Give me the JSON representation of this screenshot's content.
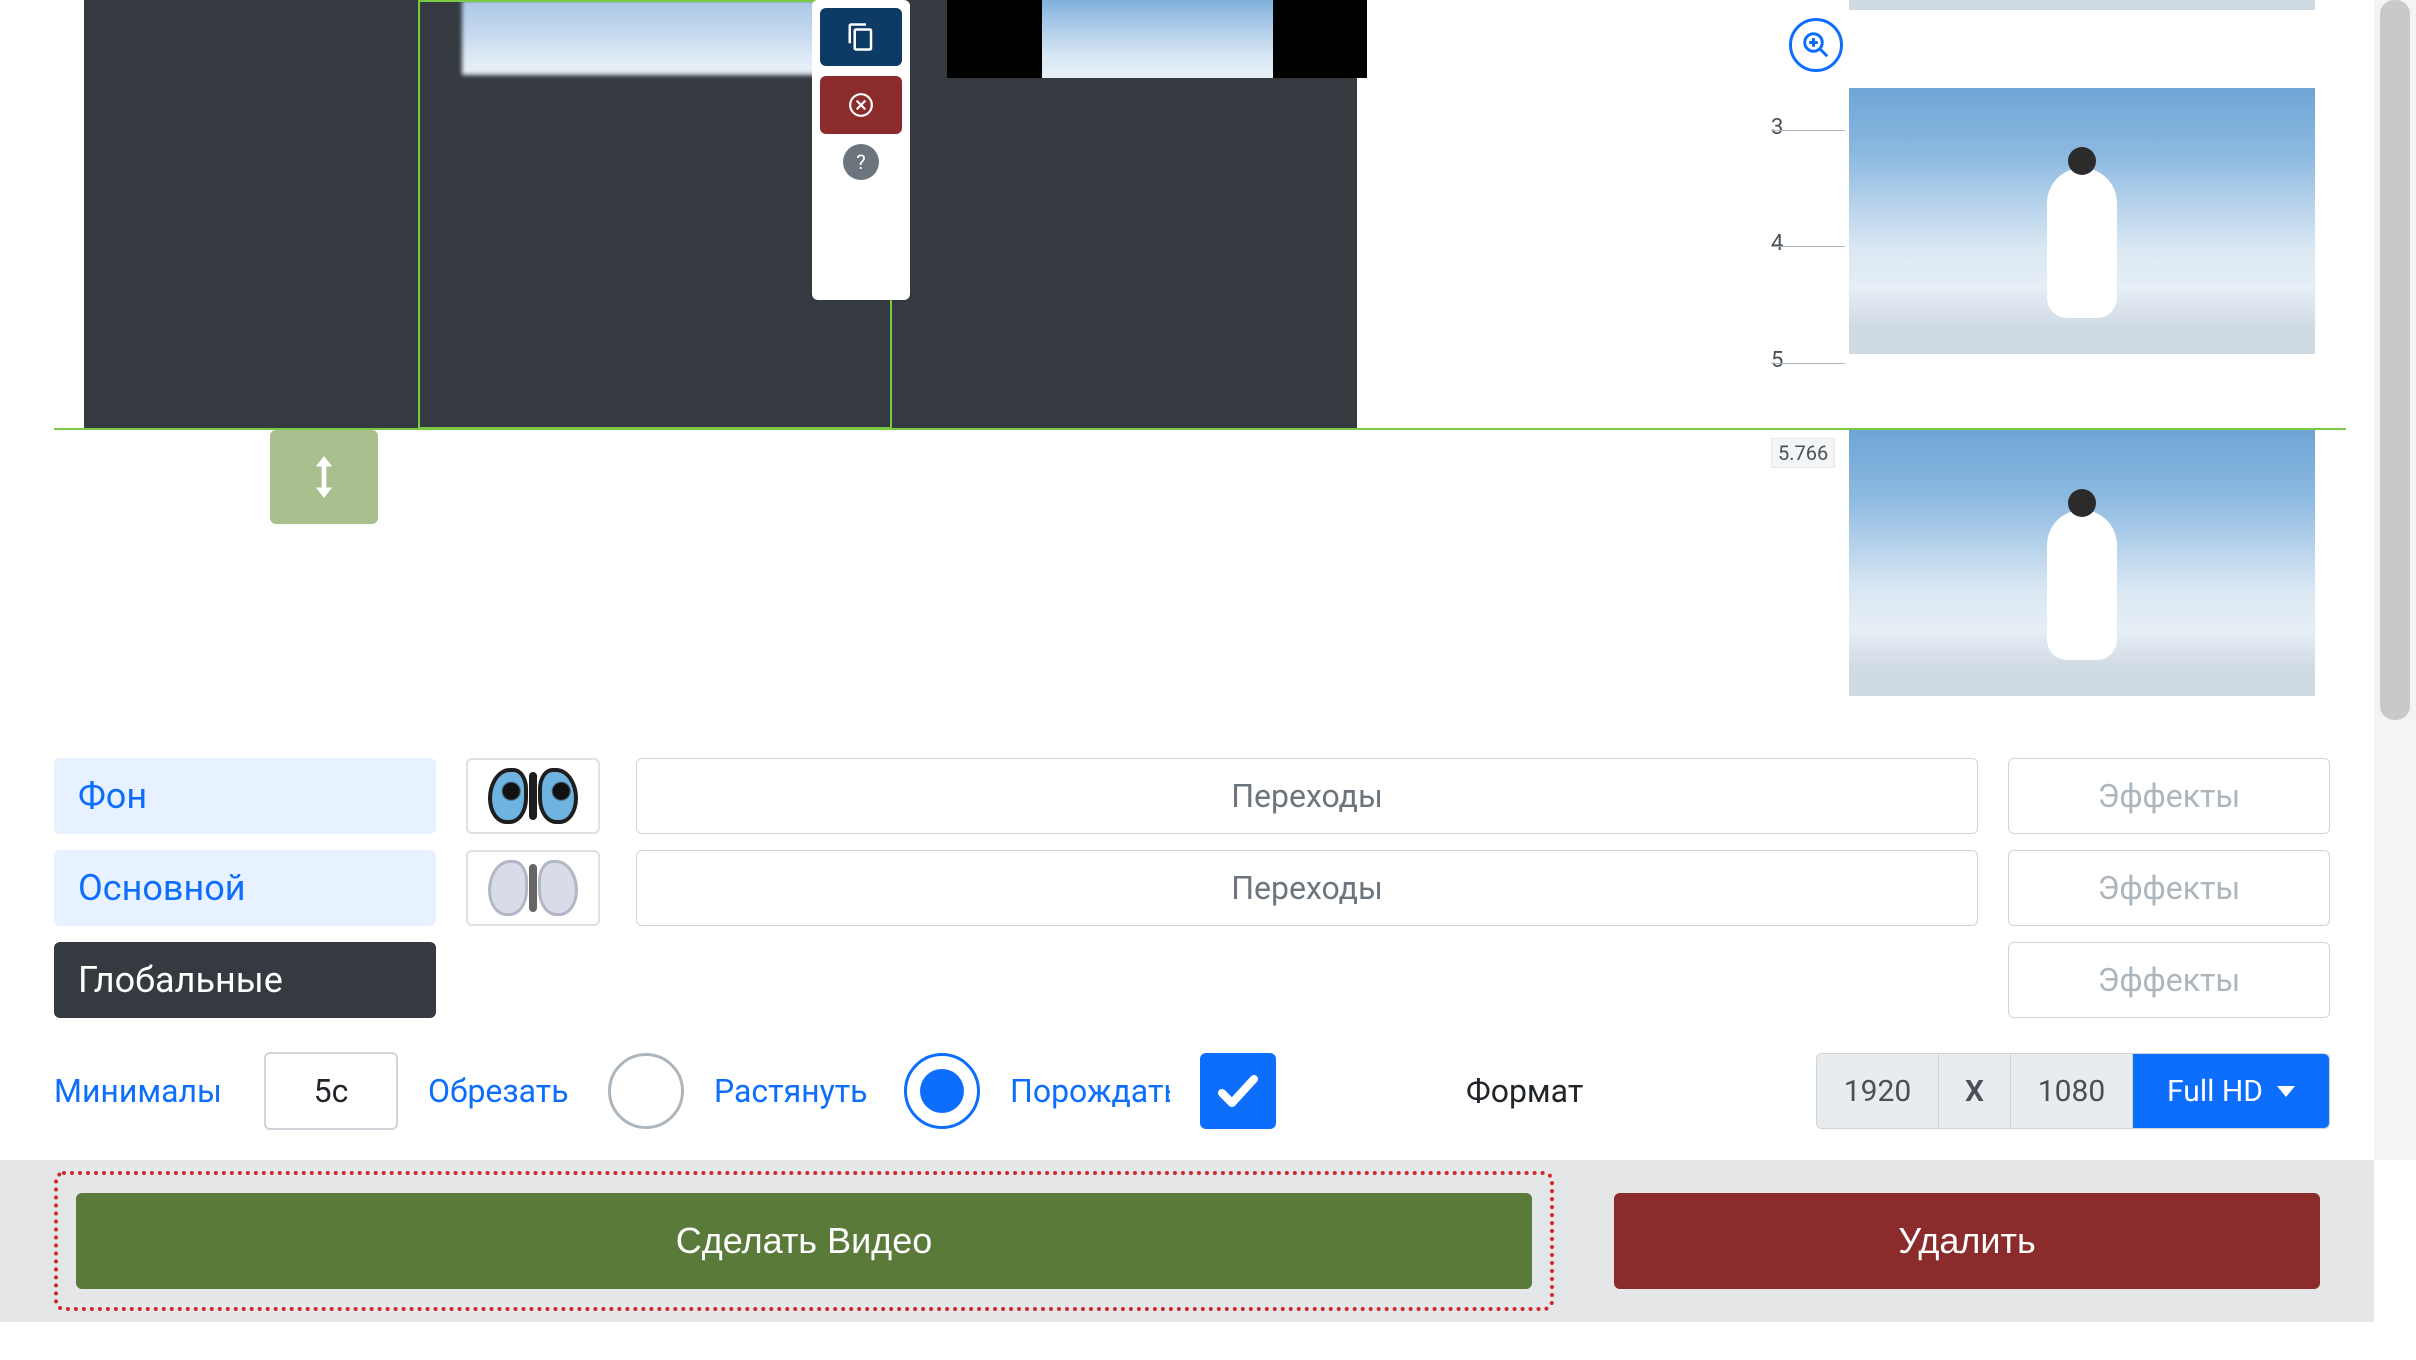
{
  "timeline": {
    "ticks": [
      "3",
      "4",
      "5",
      "5.766"
    ]
  },
  "toolbar": {
    "copy_icon": "copy",
    "delete_icon": "close",
    "help_icon": "?"
  },
  "layers": {
    "bg_label": "Фон",
    "main_label": "Основной",
    "global_label": "Глобальные"
  },
  "row_controls": {
    "transitions_placeholder": "Переходы",
    "effects_placeholder": "Эффекты"
  },
  "options": {
    "min_label": "Минималы",
    "min_value": "5с",
    "crop_label": "Обрезать",
    "stretch_label": "Растянуть",
    "spawn_label": "Порождать",
    "crop_selected": false,
    "stretch_selected": true,
    "spawn_checked": true
  },
  "format": {
    "label": "Формат",
    "width": "1920",
    "x": "X",
    "height": "1080",
    "preset": "Full HD"
  },
  "actions": {
    "make_video": "Сделать Видео",
    "delete": "Удалить"
  }
}
